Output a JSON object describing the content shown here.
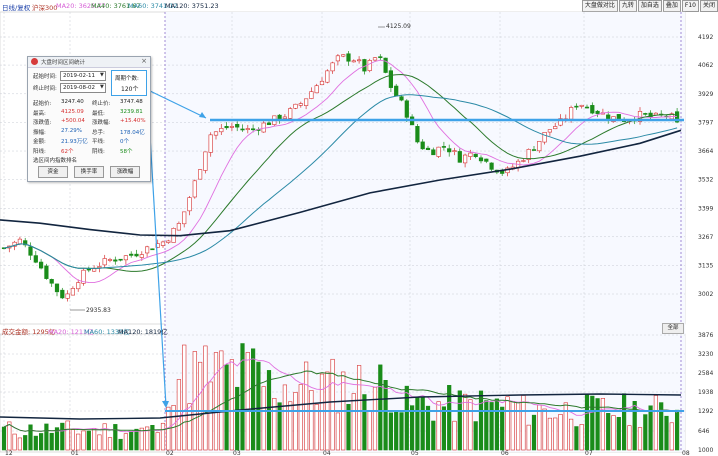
{
  "header": {
    "index_name": "日线/复权",
    "symbol": "沪深300",
    "ma20": "MA20: 3625.77",
    "ma40": "MA40: 3761.67",
    "ma60": "MA60: 3741.12",
    "ma120": "MA120: 3751.23",
    "tabs": [
      "大盘做对比",
      "九转",
      "加自选",
      "叠加",
      "F10",
      "关闭"
    ]
  },
  "volume_header": {
    "label": "成交金额: 1295亿",
    "ma20": "MA20: 1211亿",
    "ma60": "MA60: 1330亿",
    "ma120": "MA120: 1819亿"
  },
  "x_axis": [
    "12",
    "01",
    "02",
    "03",
    "04",
    "05",
    "06",
    "07",
    "08"
  ],
  "price_axis": [
    "4192",
    "4062",
    "3929",
    "3797",
    "3664",
    "3532",
    "3399",
    "3267",
    "3135",
    "3002"
  ],
  "volume_axis": [
    "3876",
    "3230",
    "2584",
    "1938",
    "1292",
    "646",
    "1000"
  ],
  "annotations": {
    "high": "4125.09",
    "low": "2935.83"
  },
  "all_button": "全部",
  "dialog": {
    "title": "大盘时间区间统计",
    "close": "×",
    "start_label": "起始时间:",
    "start_value": "2019-02-11",
    "end_label": "终止时间:",
    "end_value": "2019-08-02",
    "period_label": "周期个数:",
    "period_value": "120个",
    "rows": [
      {
        "l1": "起始价:",
        "v1": "3247.40",
        "l2": "终止价:",
        "v2": "3747.48"
      },
      {
        "l1": "最高:",
        "v1": "4125.09",
        "l2": "最低:",
        "v2": "3239.81"
      },
      {
        "l1": "涨跌值:",
        "v1": "+500.04",
        "l2": "涨跌幅:",
        "v2": "+15.40%"
      },
      {
        "l1": "振幅:",
        "v1": "27.29%",
        "l2": "总手:",
        "v2": "178.04亿"
      },
      {
        "l1": "金额:",
        "v1": "21.93万亿",
        "l2": "平线:",
        "v2": "0个"
      },
      {
        "l1": "阳线:",
        "v1": "62个",
        "l2": "阴线:",
        "v2": "58个"
      }
    ],
    "section_label": "选区间内指数排名",
    "buttons": [
      "资金",
      "换手率",
      "涨跌幅"
    ]
  },
  "colors": {
    "up": "#d62f2f",
    "down": "#1a8c1a",
    "ma_pink": "#e070e0",
    "ma_green": "#2c7a2c",
    "ma_teal": "#2b8aa6",
    "ma_navy": "#12253f",
    "highlight": "#3ea2e8"
  }
}
